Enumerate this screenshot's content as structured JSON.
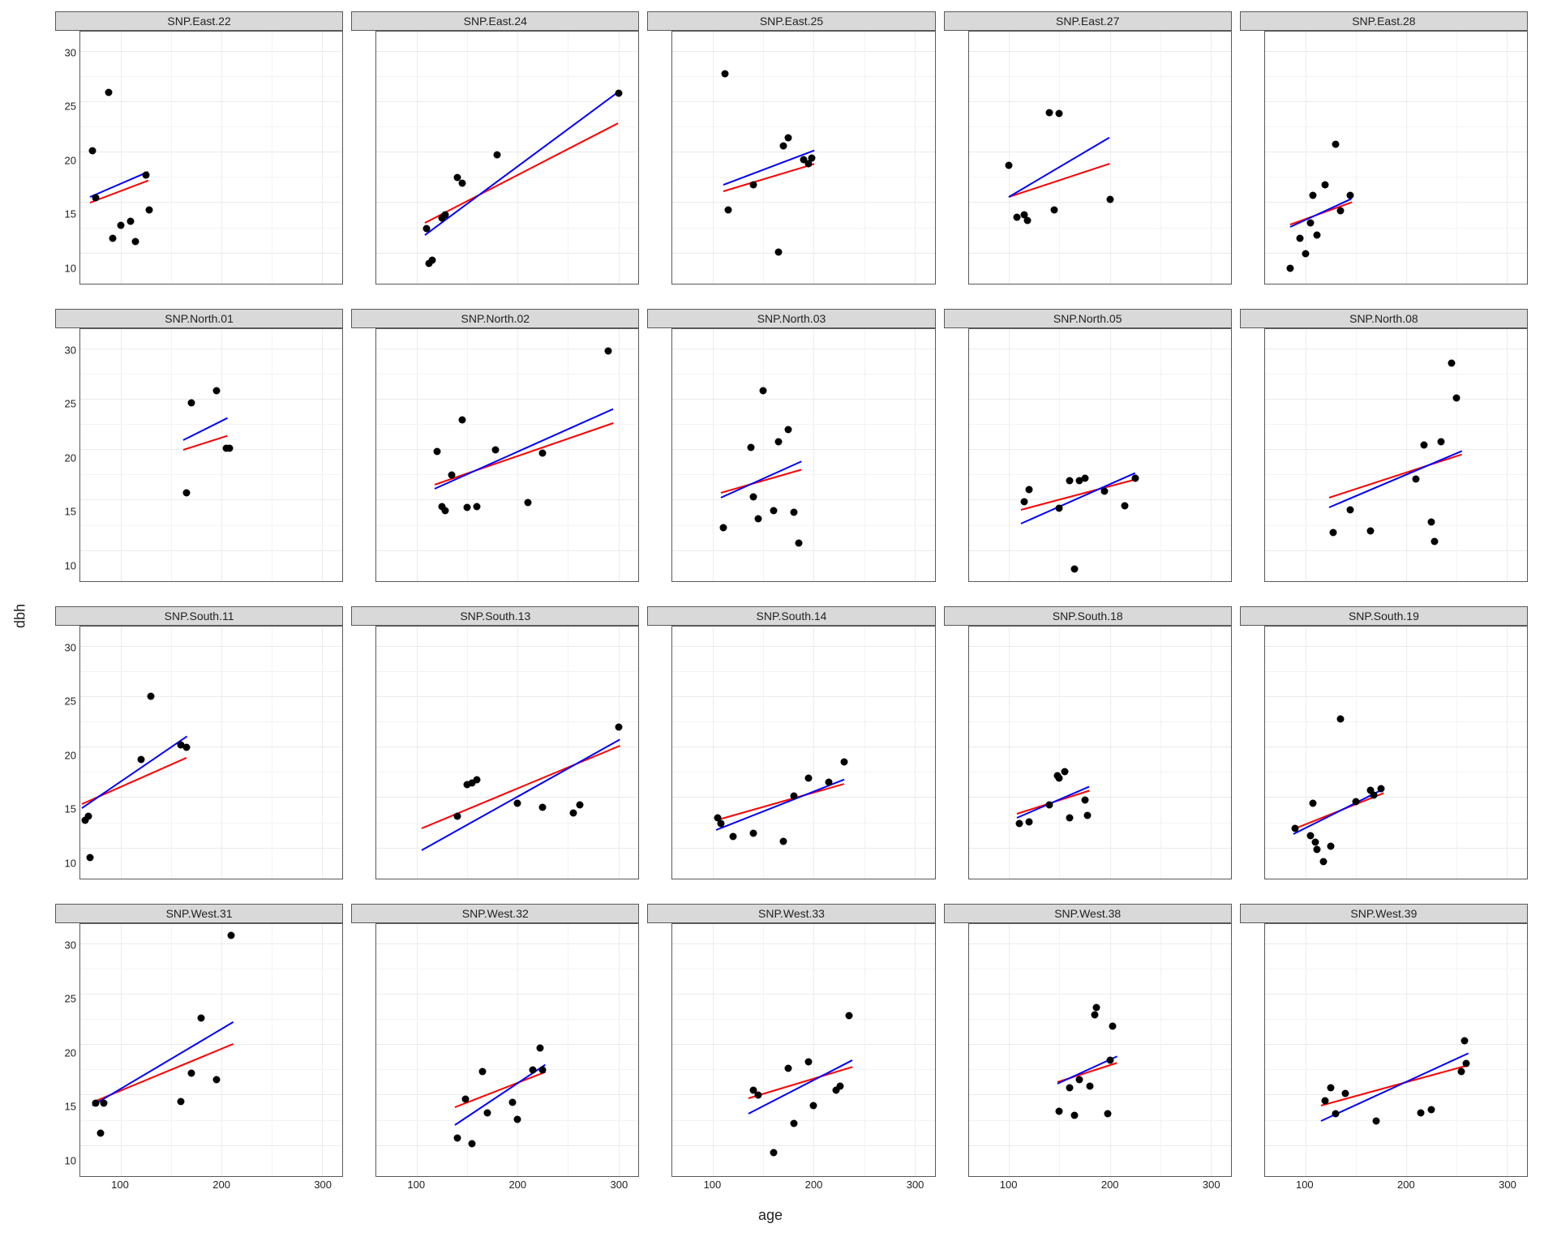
{
  "xlabel": "age",
  "ylabel": "dbh",
  "chart_data": {
    "type": "scatter",
    "xlabel": "age",
    "ylabel": "dbh",
    "xlim": [
      60,
      320
    ],
    "ylim": [
      7,
      32
    ],
    "xticks": [
      100,
      200,
      300
    ],
    "yticks": [
      10,
      15,
      20,
      25,
      30
    ],
    "series_meta": [
      {
        "name": "blue_fit",
        "color": "#0000ff",
        "type": "line"
      },
      {
        "name": "red_fit",
        "color": "#ff0000",
        "type": "line"
      }
    ],
    "facets": [
      {
        "label": "SNP.East.22",
        "points": [
          [
            72,
            20.2
          ],
          [
            75,
            15.5
          ],
          [
            88,
            26.0
          ],
          [
            92,
            11.5
          ],
          [
            100,
            12.8
          ],
          [
            110,
            13.2
          ],
          [
            115,
            11.2
          ],
          [
            125,
            17.8
          ],
          [
            128,
            14.3
          ]
        ],
        "blue": [
          [
            70,
            15.6
          ],
          [
            128,
            18.1
          ]
        ],
        "red": [
          [
            70,
            15.0
          ],
          [
            128,
            17.2
          ]
        ]
      },
      {
        "label": "SNP.East.24",
        "points": [
          [
            110,
            12.5
          ],
          [
            112,
            9.0
          ],
          [
            115,
            9.3
          ],
          [
            125,
            13.5
          ],
          [
            128,
            13.8
          ],
          [
            140,
            17.5
          ],
          [
            145,
            17.0
          ],
          [
            180,
            19.8
          ],
          [
            300,
            25.9
          ]
        ],
        "blue": [
          [
            108,
            11.8
          ],
          [
            300,
            26.0
          ]
        ],
        "red": [
          [
            108,
            13.0
          ],
          [
            300,
            22.9
          ]
        ]
      },
      {
        "label": "SNP.East.25",
        "points": [
          [
            112,
            27.8
          ],
          [
            115,
            14.3
          ],
          [
            140,
            16.8
          ],
          [
            165,
            10.1
          ],
          [
            170,
            20.7
          ],
          [
            175,
            21.5
          ],
          [
            190,
            19.3
          ],
          [
            195,
            18.9
          ],
          [
            198,
            19.5
          ]
        ],
        "blue": [
          [
            110,
            16.8
          ],
          [
            200,
            20.2
          ]
        ],
        "red": [
          [
            110,
            16.2
          ],
          [
            200,
            18.9
          ]
        ]
      },
      {
        "label": "SNP.East.27",
        "points": [
          [
            100,
            18.7
          ],
          [
            108,
            13.6
          ],
          [
            115,
            13.8
          ],
          [
            118,
            13.3
          ],
          [
            140,
            24.0
          ],
          [
            145,
            14.3
          ],
          [
            150,
            23.9
          ],
          [
            200,
            15.4
          ]
        ],
        "blue": [
          [
            100,
            15.6
          ],
          [
            200,
            21.5
          ]
        ],
        "red": [
          [
            100,
            15.6
          ],
          [
            200,
            18.9
          ]
        ]
      },
      {
        "label": "SNP.East.28",
        "points": [
          [
            85,
            8.5
          ],
          [
            95,
            11.5
          ],
          [
            100,
            10.0
          ],
          [
            105,
            13.0
          ],
          [
            108,
            15.8
          ],
          [
            112,
            11.8
          ],
          [
            120,
            16.8
          ],
          [
            130,
            20.8
          ],
          [
            135,
            14.2
          ],
          [
            145,
            15.8
          ]
        ],
        "blue": [
          [
            85,
            12.6
          ],
          [
            146,
            15.4
          ]
        ],
        "red": [
          [
            85,
            12.9
          ],
          [
            146,
            15.1
          ]
        ]
      },
      {
        "label": "SNP.North.01",
        "points": [
          [
            165,
            15.8
          ],
          [
            170,
            24.7
          ],
          [
            195,
            25.9
          ],
          [
            205,
            20.2
          ],
          [
            208,
            20.2
          ]
        ],
        "blue": [
          [
            162,
            21.0
          ],
          [
            206,
            23.2
          ]
        ],
        "red": [
          [
            162,
            20.0
          ],
          [
            206,
            21.4
          ]
        ]
      },
      {
        "label": "SNP.North.02",
        "points": [
          [
            120,
            19.9
          ],
          [
            125,
            14.4
          ],
          [
            128,
            14.0
          ],
          [
            135,
            17.5
          ],
          [
            145,
            23.0
          ],
          [
            150,
            14.3
          ],
          [
            160,
            14.4
          ],
          [
            178,
            20.0
          ],
          [
            210,
            14.8
          ],
          [
            225,
            19.7
          ],
          [
            290,
            29.8
          ]
        ],
        "blue": [
          [
            118,
            16.2
          ],
          [
            295,
            24.1
          ]
        ],
        "red": [
          [
            118,
            16.6
          ],
          [
            295,
            22.7
          ]
        ]
      },
      {
        "label": "SNP.North.03",
        "points": [
          [
            110,
            12.3
          ],
          [
            138,
            20.3
          ],
          [
            140,
            15.4
          ],
          [
            145,
            13.2
          ],
          [
            150,
            25.9
          ],
          [
            160,
            14.0
          ],
          [
            165,
            20.8
          ],
          [
            175,
            22.0
          ],
          [
            180,
            13.8
          ],
          [
            185,
            10.8
          ]
        ],
        "blue": [
          [
            108,
            15.3
          ],
          [
            188,
            18.9
          ]
        ],
        "red": [
          [
            108,
            15.8
          ],
          [
            188,
            18.1
          ]
        ]
      },
      {
        "label": "SNP.North.05",
        "points": [
          [
            115,
            14.9
          ],
          [
            120,
            16.1
          ],
          [
            150,
            14.2
          ],
          [
            160,
            17.0
          ],
          [
            165,
            8.2
          ],
          [
            170,
            17.0
          ],
          [
            175,
            17.2
          ],
          [
            195,
            15.9
          ],
          [
            215,
            14.5
          ],
          [
            225,
            17.2
          ]
        ],
        "blue": [
          [
            112,
            12.7
          ],
          [
            225,
            17.7
          ]
        ],
        "red": [
          [
            112,
            14.1
          ],
          [
            225,
            17.1
          ]
        ]
      },
      {
        "label": "SNP.North.08",
        "points": [
          [
            128,
            11.8
          ],
          [
            145,
            14.1
          ],
          [
            165,
            12.0
          ],
          [
            210,
            17.1
          ],
          [
            218,
            20.5
          ],
          [
            225,
            12.9
          ],
          [
            228,
            10.9
          ],
          [
            235,
            20.8
          ],
          [
            245,
            28.6
          ],
          [
            250,
            25.2
          ]
        ],
        "blue": [
          [
            124,
            14.3
          ],
          [
            256,
            19.9
          ]
        ],
        "red": [
          [
            124,
            15.3
          ],
          [
            256,
            19.6
          ]
        ]
      },
      {
        "label": "SNP.South.11",
        "points": [
          [
            65,
            12.8
          ],
          [
            68,
            13.2
          ],
          [
            70,
            9.1
          ],
          [
            120,
            18.8
          ],
          [
            130,
            25.1
          ],
          [
            160,
            20.3
          ],
          [
            165,
            20.0
          ]
        ],
        "blue": [
          [
            62,
            14.0
          ],
          [
            166,
            21.1
          ]
        ],
        "red": [
          [
            62,
            14.4
          ],
          [
            166,
            19.0
          ]
        ]
      },
      {
        "label": "SNP.South.13",
        "points": [
          [
            140,
            13.2
          ],
          [
            150,
            16.3
          ],
          [
            155,
            16.5
          ],
          [
            160,
            16.8
          ],
          [
            200,
            14.5
          ],
          [
            225,
            14.1
          ],
          [
            255,
            13.5
          ],
          [
            262,
            14.3
          ],
          [
            300,
            22.0
          ]
        ],
        "blue": [
          [
            105,
            9.8
          ],
          [
            302,
            20.8
          ]
        ],
        "red": [
          [
            105,
            12.0
          ],
          [
            302,
            20.2
          ]
        ]
      },
      {
        "label": "SNP.South.14",
        "points": [
          [
            105,
            13.0
          ],
          [
            108,
            12.5
          ],
          [
            120,
            11.2
          ],
          [
            140,
            11.5
          ],
          [
            170,
            10.7
          ],
          [
            180,
            15.2
          ],
          [
            195,
            17.0
          ],
          [
            215,
            16.6
          ],
          [
            230,
            18.6
          ]
        ],
        "blue": [
          [
            103,
            11.8
          ],
          [
            230,
            16.8
          ]
        ],
        "red": [
          [
            103,
            12.8
          ],
          [
            230,
            16.4
          ]
        ]
      },
      {
        "label": "SNP.South.18",
        "points": [
          [
            110,
            12.5
          ],
          [
            120,
            12.6
          ],
          [
            140,
            14.3
          ],
          [
            148,
            17.2
          ],
          [
            150,
            17.0
          ],
          [
            155,
            17.6
          ],
          [
            160,
            13.0
          ],
          [
            175,
            14.8
          ],
          [
            178,
            13.3
          ]
        ],
        "blue": [
          [
            108,
            13.0
          ],
          [
            180,
            16.1
          ]
        ],
        "red": [
          [
            108,
            13.4
          ],
          [
            180,
            15.7
          ]
        ]
      },
      {
        "label": "SNP.South.19",
        "points": [
          [
            90,
            12.0
          ],
          [
            105,
            11.3
          ],
          [
            108,
            14.5
          ],
          [
            110,
            10.6
          ],
          [
            112,
            9.9
          ],
          [
            118,
            8.7
          ],
          [
            125,
            10.2
          ],
          [
            135,
            22.8
          ],
          [
            150,
            14.6
          ],
          [
            165,
            15.8
          ],
          [
            168,
            15.3
          ],
          [
            175,
            15.9
          ]
        ],
        "blue": [
          [
            88,
            11.4
          ],
          [
            178,
            15.9
          ]
        ],
        "red": [
          [
            88,
            11.9
          ],
          [
            178,
            15.5
          ]
        ]
      },
      {
        "label": "SNP.West.31",
        "points": [
          [
            75,
            14.2
          ],
          [
            80,
            11.3
          ],
          [
            83,
            14.2
          ],
          [
            160,
            14.4
          ],
          [
            170,
            17.2
          ],
          [
            180,
            22.7
          ],
          [
            195,
            16.6
          ],
          [
            210,
            30.9
          ]
        ],
        "blue": [
          [
            72,
            14.0
          ],
          [
            212,
            22.3
          ]
        ],
        "red": [
          [
            72,
            14.3
          ],
          [
            212,
            20.1
          ]
        ]
      },
      {
        "label": "SNP.West.32",
        "points": [
          [
            140,
            10.8
          ],
          [
            148,
            14.6
          ],
          [
            155,
            10.2
          ],
          [
            165,
            17.4
          ],
          [
            170,
            13.3
          ],
          [
            195,
            14.3
          ],
          [
            200,
            12.6
          ],
          [
            215,
            17.5
          ],
          [
            222,
            19.7
          ],
          [
            225,
            17.5
          ]
        ],
        "blue": [
          [
            138,
            12.1
          ],
          [
            228,
            18.1
          ]
        ],
        "red": [
          [
            138,
            13.8
          ],
          [
            228,
            17.3
          ]
        ]
      },
      {
        "label": "SNP.West.33",
        "points": [
          [
            140,
            15.5
          ],
          [
            145,
            15.0
          ],
          [
            160,
            9.3
          ],
          [
            175,
            17.7
          ],
          [
            180,
            12.2
          ],
          [
            195,
            18.3
          ],
          [
            200,
            14.0
          ],
          [
            222,
            15.5
          ],
          [
            226,
            15.9
          ],
          [
            235,
            22.9
          ]
        ],
        "blue": [
          [
            135,
            13.2
          ],
          [
            238,
            18.5
          ]
        ],
        "red": [
          [
            135,
            14.7
          ],
          [
            238,
            17.8
          ]
        ]
      },
      {
        "label": "SNP.West.38",
        "points": [
          [
            150,
            13.4
          ],
          [
            160,
            15.8
          ],
          [
            165,
            13.0
          ],
          [
            170,
            16.6
          ],
          [
            180,
            15.9
          ],
          [
            185,
            23.0
          ],
          [
            187,
            23.7
          ],
          [
            198,
            13.2
          ],
          [
            200,
            18.5
          ],
          [
            203,
            21.9
          ]
        ],
        "blue": [
          [
            148,
            16.2
          ],
          [
            207,
            18.9
          ]
        ],
        "red": [
          [
            148,
            16.3
          ],
          [
            207,
            18.2
          ]
        ]
      },
      {
        "label": "SNP.West.39",
        "points": [
          [
            120,
            14.5
          ],
          [
            125,
            15.8
          ],
          [
            130,
            13.2
          ],
          [
            140,
            15.2
          ],
          [
            170,
            12.5
          ],
          [
            215,
            13.3
          ],
          [
            225,
            13.6
          ],
          [
            255,
            17.4
          ],
          [
            258,
            20.4
          ],
          [
            260,
            18.2
          ]
        ],
        "blue": [
          [
            116,
            12.5
          ],
          [
            262,
            19.2
          ]
        ],
        "red": [
          [
            116,
            14.0
          ],
          [
            262,
            18.0
          ]
        ]
      }
    ]
  }
}
